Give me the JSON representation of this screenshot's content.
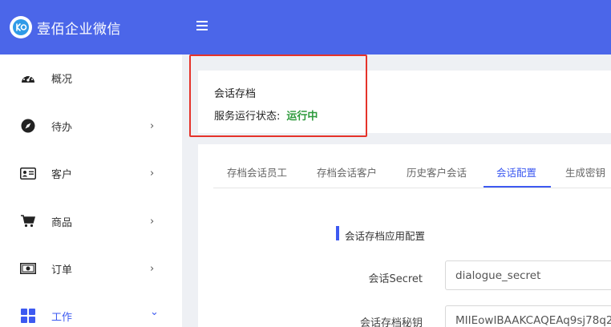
{
  "brand": {
    "title": "壹佰企业微信",
    "logo_icon": "ko-logo-icon"
  },
  "header": {
    "menu_icon": "hamburger-icon"
  },
  "sidebar": {
    "items": [
      {
        "label": "概况",
        "icon": "dashboard-gauge-icon",
        "arrow": ""
      },
      {
        "label": "待办",
        "icon": "compass-icon",
        "arrow": "›"
      },
      {
        "label": "客户",
        "icon": "id-card-icon",
        "arrow": "›"
      },
      {
        "label": "商品",
        "icon": "cart-icon",
        "arrow": "›"
      },
      {
        "label": "订单",
        "icon": "money-bill-icon",
        "arrow": "›"
      },
      {
        "label": "工作",
        "icon": "grid-icon",
        "arrow": "⌄"
      }
    ],
    "active_index": 5
  },
  "status": {
    "title": "会话存档",
    "label": "服务运行状态:",
    "value": "运行中",
    "value_color": "#2d9a3c"
  },
  "tabs": [
    {
      "label": "存档会话员工"
    },
    {
      "label": "存档会话客户"
    },
    {
      "label": "历史客户会话"
    },
    {
      "label": "会话配置"
    },
    {
      "label": "生成密钥"
    }
  ],
  "active_tab_index": 3,
  "config": {
    "section_title": "会话存档应用配置",
    "fields": [
      {
        "label": "会话Secret",
        "value": "dialogue_secret"
      },
      {
        "label": "会话存档秘钥",
        "value": "MIIEowIBAAKCAQEAq9sj78q2"
      }
    ]
  },
  "colors": {
    "primary": "#4b66e9",
    "accent": "#3d5af1",
    "highlight": "#e5332a"
  }
}
